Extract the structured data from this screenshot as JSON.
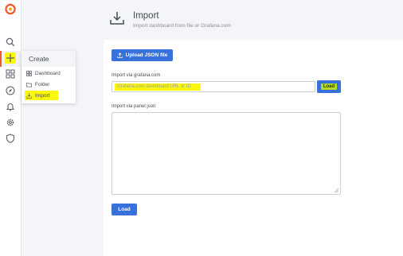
{
  "header": {
    "title": "Import",
    "subtitle": "Import dashboard from file or Grafana.com"
  },
  "sidebar": {
    "items": [
      {
        "icon": "search-icon"
      },
      {
        "icon": "plus-icon",
        "active": true
      },
      {
        "icon": "dashboards-icon"
      },
      {
        "icon": "compass-icon"
      },
      {
        "icon": "bell-icon"
      },
      {
        "icon": "gear-icon"
      },
      {
        "icon": "shield-icon"
      }
    ]
  },
  "create_menu": {
    "header": "Create",
    "items": [
      {
        "label": "Dashboard",
        "icon": "dashboard-grid-icon"
      },
      {
        "label": "Folder",
        "icon": "folder-icon"
      },
      {
        "label": "Import",
        "icon": "import-icon",
        "highlighted": true
      }
    ]
  },
  "main": {
    "upload_button": "Upload JSON file",
    "grafana_label": "Import via grafana.com",
    "grafana_placeholder": "Grafana.com dashboard URL or ID",
    "grafana_load_button": "Load",
    "panel_json_label": "Import via panel json",
    "panel_json_value": "",
    "load_button": "Load"
  },
  "colors": {
    "accent": "#3871dc",
    "highlight": "#faf60e",
    "brand": "#f05a28"
  }
}
